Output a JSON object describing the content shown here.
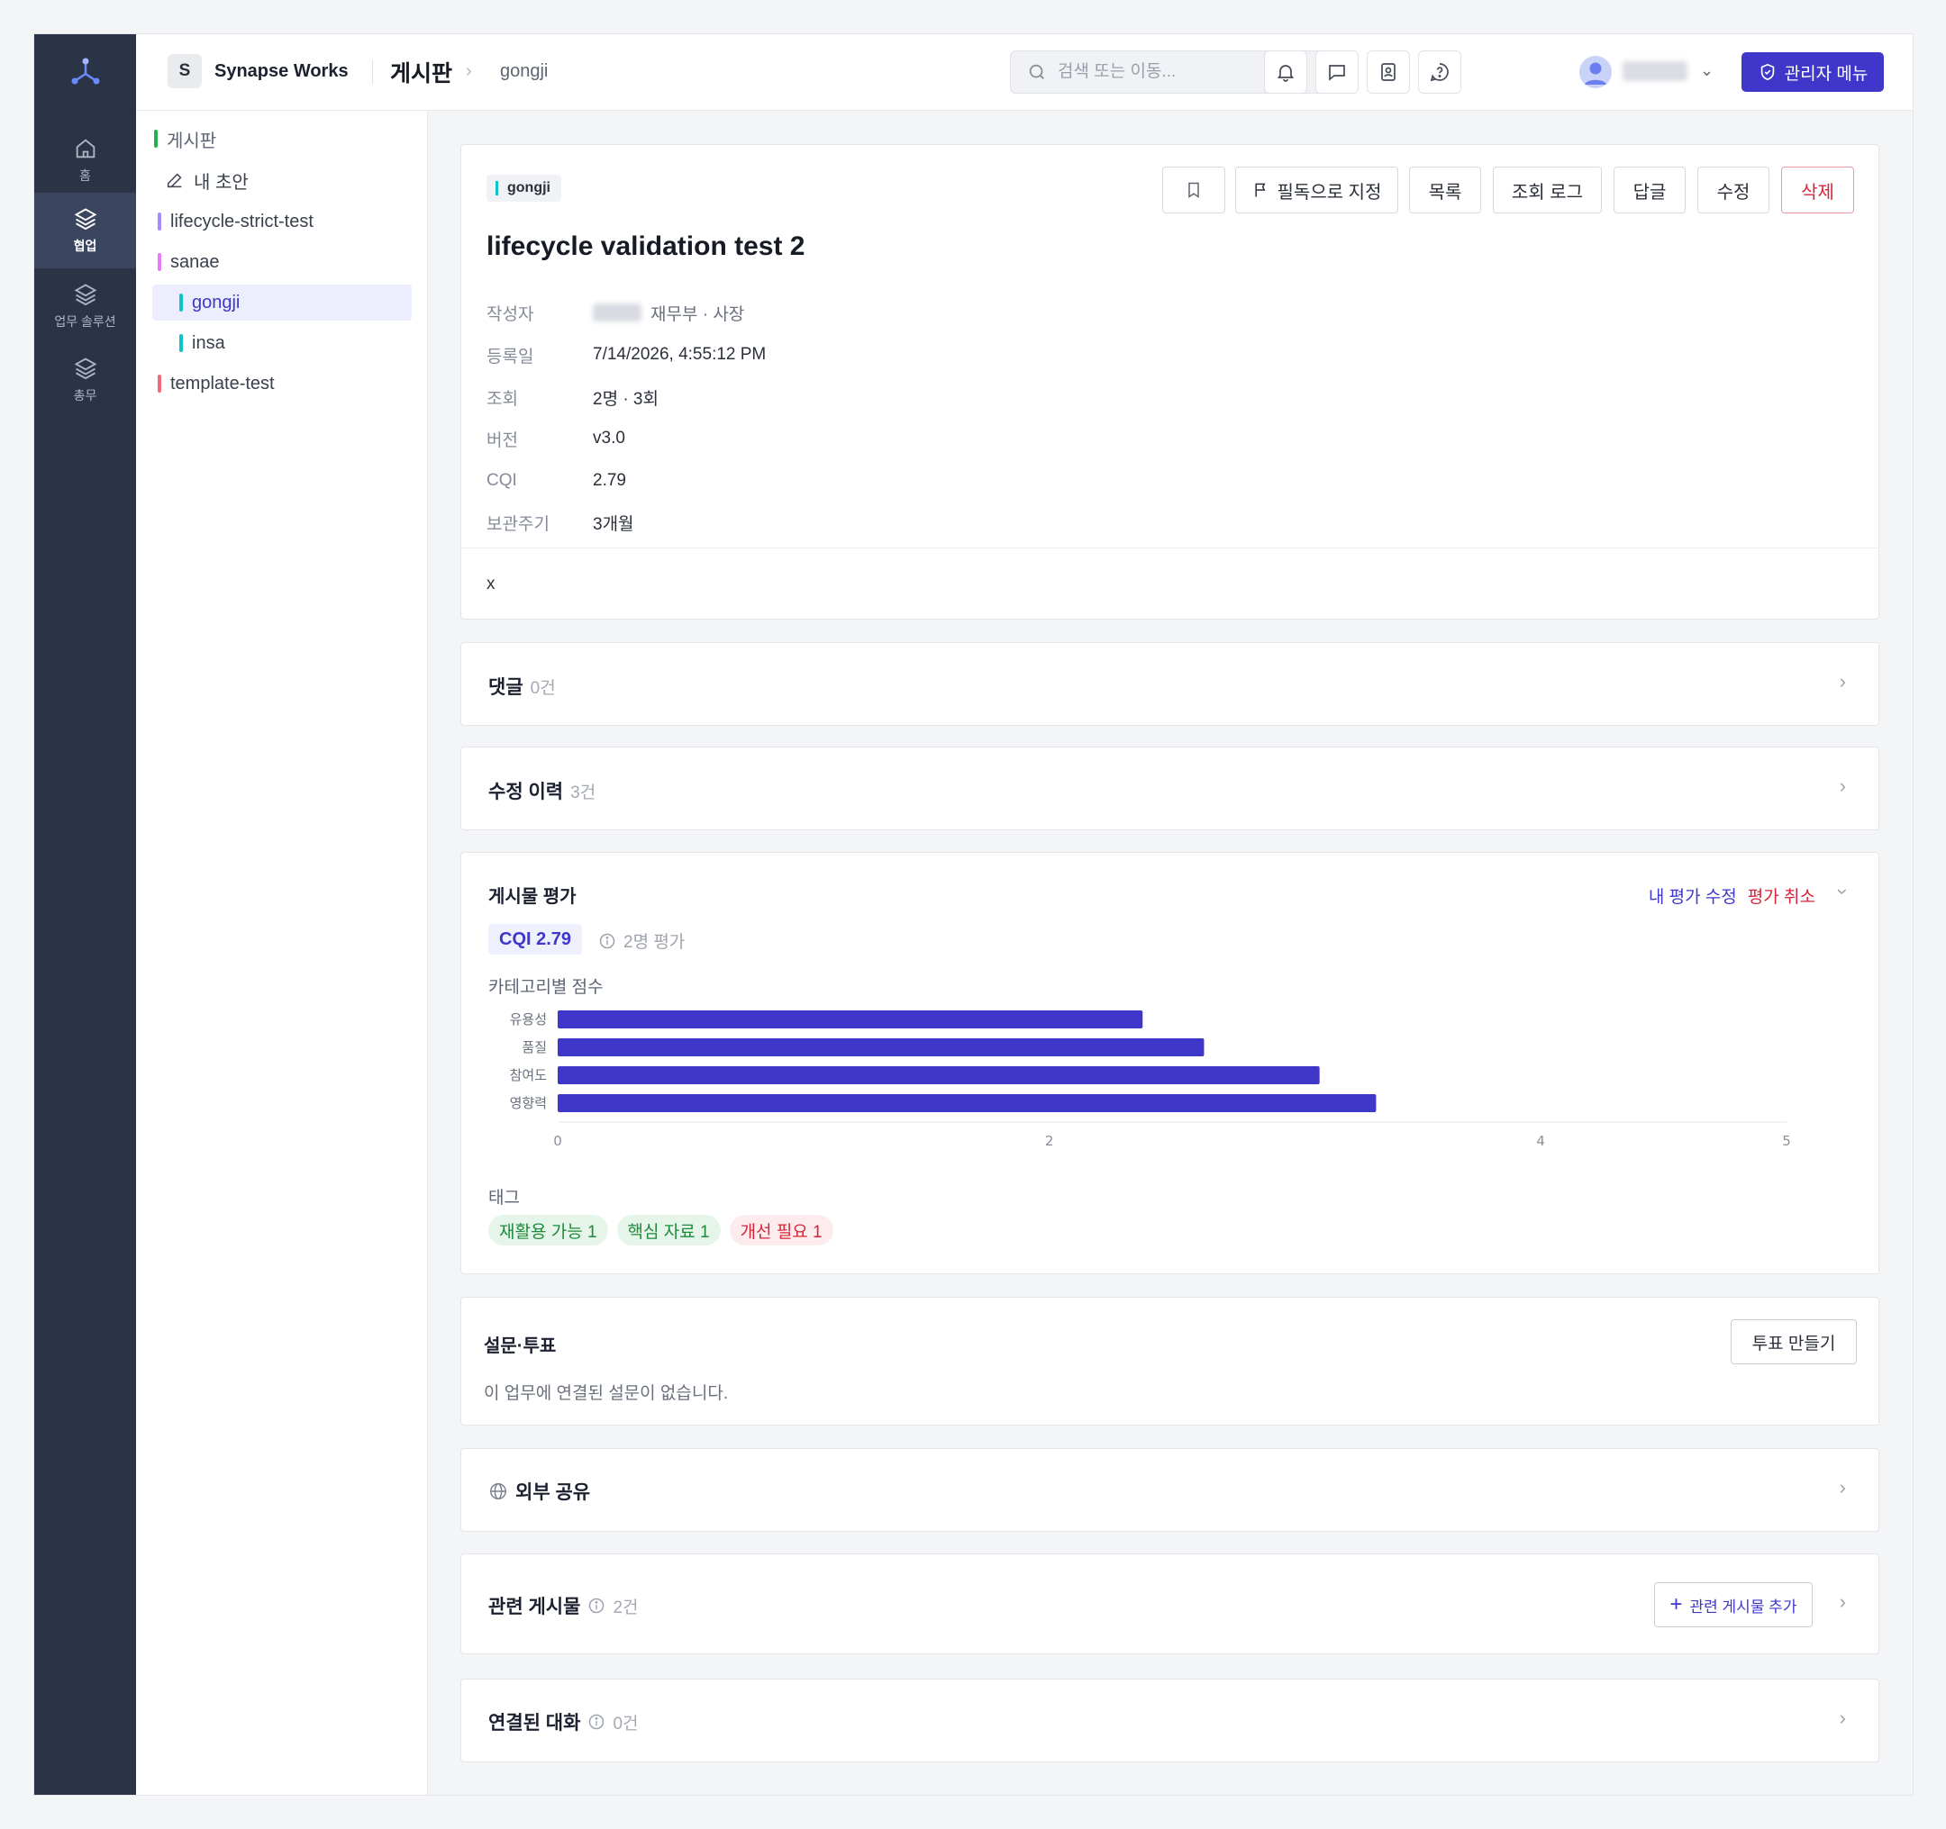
{
  "rail": {
    "items": [
      {
        "label": "홈",
        "icon": "home-icon"
      },
      {
        "label": "협업",
        "icon": "layers-icon",
        "active": true
      },
      {
        "label": "업무 솔루션",
        "icon": "layers-icon"
      },
      {
        "label": "총무",
        "icon": "layers-icon"
      }
    ]
  },
  "header": {
    "workspace_initial": "S",
    "workspace_name": "Synapse Works",
    "title": "게시판",
    "breadcrumb": "gongji",
    "search_placeholder": "검색 또는 이동...",
    "admin_label": "관리자 메뉴"
  },
  "tree": {
    "items": [
      {
        "label": "게시판",
        "color": "#22b14c",
        "indent": 0
      },
      {
        "label": "내 초안",
        "icon": "pencil-icon",
        "indent": 0
      },
      {
        "label": "lifecycle-strict-test",
        "color": "#a78bfa",
        "indent": 0
      },
      {
        "label": "sanae",
        "color": "#e879f9",
        "indent": 0
      },
      {
        "label": "gongji",
        "color": "#10c3c9",
        "indent": 1,
        "active": true
      },
      {
        "label": "insa",
        "color": "#10c3c9",
        "indent": 1
      },
      {
        "label": "template-test",
        "color": "#f06a7e",
        "indent": 0
      }
    ]
  },
  "post": {
    "board_tag": "gongji",
    "actions": {
      "pin": "필독으로 지정",
      "list": "목록",
      "view_log": "조회 로그",
      "reply": "답글",
      "edit": "수정",
      "delete": "삭제"
    },
    "title": "lifecycle validation test 2",
    "meta": [
      {
        "label": "작성자",
        "value": "재무부 · 사장"
      },
      {
        "label": "등록일",
        "value": "7/14/2026, 4:55:12 PM"
      },
      {
        "label": "조회",
        "value": "2명 · 3회"
      },
      {
        "label": "버전",
        "value": "v3.0"
      },
      {
        "label": "CQI",
        "value": "2.79"
      },
      {
        "label": "보관주기",
        "value": "3개월"
      }
    ],
    "body": "x"
  },
  "comments": {
    "title": "댓글",
    "count": "0건"
  },
  "history": {
    "title": "수정 이력",
    "count": "3건"
  },
  "rating": {
    "title": "게시물 평가",
    "edit_link": "내 평가 수정",
    "cancel_link": "평가 취소",
    "cqi_badge": "CQI 2.79",
    "raters": "2명 평가",
    "category_label": "카테고리별 점수",
    "tags_label": "태그",
    "tags": [
      {
        "label": "재활용 가능 1",
        "bg": "#e6f5ea",
        "fg": "#1f8a3b"
      },
      {
        "label": "핵심 자료 1",
        "bg": "#e6f5ea",
        "fg": "#1f8a3b"
      },
      {
        "label": "개선 필요 1",
        "bg": "#fdecee",
        "fg": "#d3263a"
      }
    ]
  },
  "chart_data": {
    "type": "bar",
    "orientation": "horizontal",
    "categories": [
      "유용성",
      "품질",
      "참여도",
      "영향력"
    ],
    "values": [
      2.38,
      2.63,
      3.1,
      3.33
    ],
    "xlim": [
      0,
      5
    ],
    "xticks": [
      "0",
      "2",
      "4",
      "5"
    ],
    "color": "#3f37c9"
  },
  "survey": {
    "title": "설문·투표",
    "create_label": "투표 만들기",
    "empty_text": "이 업무에 연결된 설문이 없습니다."
  },
  "share": {
    "title": "외부 공유"
  },
  "related": {
    "title": "관련 게시물",
    "count": "2건",
    "add_label": "관련 게시물 추가"
  },
  "conversations": {
    "title": "연결된 대화",
    "count": "0건"
  }
}
